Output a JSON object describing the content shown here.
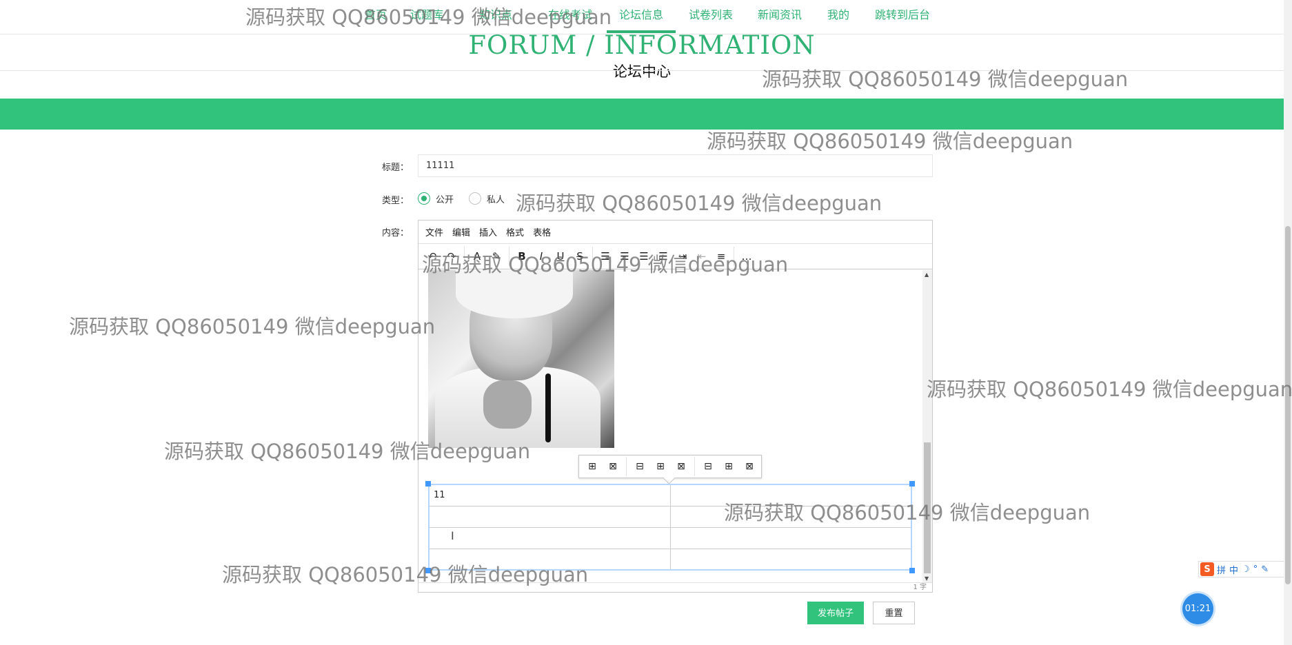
{
  "nav": {
    "items": [
      {
        "label": "首页"
      },
      {
        "label": "试题库"
      },
      {
        "label": "知识点"
      },
      {
        "label": "在线考试"
      },
      {
        "label": "论坛信息"
      },
      {
        "label": "试卷列表"
      },
      {
        "label": "新闻资讯"
      },
      {
        "label": "我的"
      },
      {
        "label": "跳转到后台"
      }
    ],
    "active_index": 4
  },
  "header": {
    "title_en": "FORUM / INFORMATION",
    "title_cn": "论坛中心"
  },
  "form": {
    "title_label": "标题：",
    "title_value": "11111",
    "type_label": "类型：",
    "type_options": [
      {
        "label": "公开",
        "selected": true
      },
      {
        "label": "私人",
        "selected": false
      }
    ],
    "content_label": "内容："
  },
  "editor": {
    "menu": [
      "文件",
      "编辑",
      "插入",
      "格式",
      "表格"
    ],
    "toolbar_icons": [
      "undo-icon",
      "redo-icon",
      "font-color-icon",
      "highlight-icon",
      "bold-icon",
      "italic-icon",
      "underline-icon",
      "strikethrough-icon",
      "align-left-icon",
      "align-center-icon",
      "align-right-icon",
      "align-justify-icon",
      "indent-icon",
      "outdent-icon",
      "list-icon",
      "more-icon"
    ],
    "table_toolbar_icons": [
      "table-props-icon",
      "delete-table-icon",
      "insert-row-before-icon",
      "insert-row-after-icon",
      "delete-row-icon",
      "insert-col-before-icon",
      "insert-col-after-icon",
      "delete-col-icon"
    ],
    "table_rows": [
      [
        "11",
        ""
      ],
      [
        "",
        ""
      ],
      [
        "",
        ""
      ],
      [
        "",
        ""
      ]
    ],
    "word_count": "1 字"
  },
  "buttons": {
    "submit": "发布帖子",
    "reset": "重置"
  },
  "timer": "01:21",
  "ime": {
    "logo": "S",
    "items": [
      "拼",
      "中",
      "☽",
      "°",
      "✎"
    ]
  },
  "watermark": "源码获取 QQ86050149 微信deepguan",
  "colors": {
    "accent": "#2fb274",
    "band": "#31c27c",
    "timer": "#2f8ce6"
  }
}
